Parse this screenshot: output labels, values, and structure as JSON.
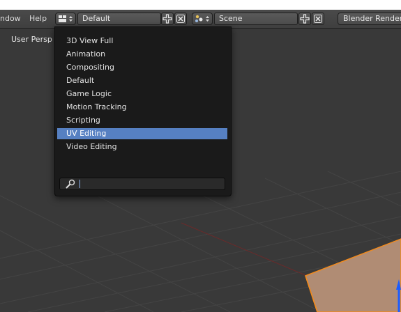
{
  "header": {
    "menus": [
      "ndow",
      "Help"
    ],
    "layout_field": "Default",
    "scene_field": "Scene",
    "render_engine": "Blender Render"
  },
  "viewport": {
    "label": "User Persp"
  },
  "layout_popup": {
    "items": [
      "3D View Full",
      "Animation",
      "Compositing",
      "Default",
      "Game Logic",
      "Motion Tracking",
      "Scripting",
      "UV Editing",
      "Video Editing"
    ],
    "active_item": "UV Editing",
    "search_value": ""
  },
  "colors": {
    "highlight": "#5680c2",
    "selection_outline": "#f28a1c"
  }
}
